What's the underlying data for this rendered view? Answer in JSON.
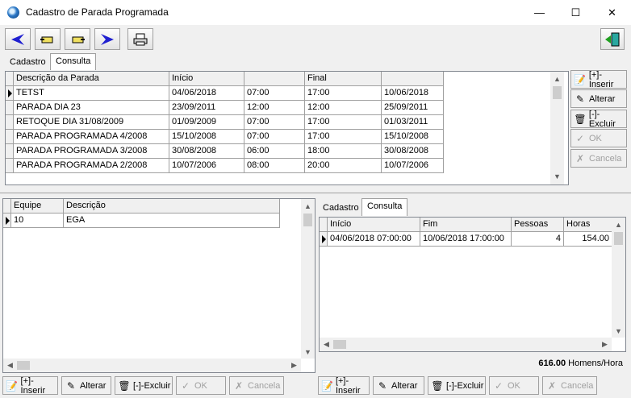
{
  "window": {
    "title": "Cadastro de Parada Programada",
    "minimize": "—",
    "maximize": "☐",
    "close": "✕"
  },
  "toolbar": {
    "buttons": [
      "back-icon",
      "hand-left-icon",
      "hand-right-icon",
      "forward-icon",
      "print-icon"
    ],
    "exit": "exit-icon"
  },
  "top_tabs": {
    "cadastro": "Cadastro",
    "consulta": "Consulta"
  },
  "paradas": {
    "columns": [
      "Descrição da Parada",
      "Início",
      "",
      "Final",
      ""
    ],
    "rows": [
      [
        "TETST",
        "04/06/2018",
        "07:00",
        "17:00",
        "10/06/2018"
      ],
      [
        "PARADA DIA 23",
        "23/09/2011",
        "12:00",
        "12:00",
        "25/09/2011"
      ],
      [
        "RETOQUE DIA 31/08/2009",
        "01/09/2009",
        "07:00",
        "17:00",
        "01/03/2011"
      ],
      [
        "PARADA PROGRAMADA  4/2008",
        "15/10/2008",
        "07:00",
        "17:00",
        "15/10/2008"
      ],
      [
        "PARADA PROGRAMADA 3/2008",
        "30/08/2008",
        "06:00",
        "18:00",
        "30/08/2008"
      ],
      [
        "PARADA PROGRAMADA 2/2008",
        "10/07/2006",
        "08:00",
        "20:00",
        "10/07/2006"
      ]
    ]
  },
  "side_buttons": {
    "inserir": "[+]-Inserir",
    "alterar": "Alterar",
    "excluir": "[-]-Excluir",
    "ok": "OK",
    "cancela": "Cancela"
  },
  "equipes": {
    "columns": [
      "Equipe",
      "Descrição"
    ],
    "rows": [
      [
        "10",
        "EGA"
      ]
    ]
  },
  "lower_tabs": {
    "cadastro": "Cadastro",
    "consulta": "Consulta"
  },
  "horarios": {
    "columns": [
      "Início",
      "Fim",
      "Pessoas",
      "Horas"
    ],
    "rows": [
      [
        "04/06/2018 07:00:00",
        "10/06/2018 17:00:00",
        "4",
        "154.00"
      ]
    ]
  },
  "total": {
    "value": "616.00",
    "unit": "Homens/Hora"
  },
  "left_buttons": {
    "inserir": "[+]-Inserir",
    "alterar": "Alterar",
    "excluir": "[-]-Excluir",
    "ok": "OK",
    "cancela": "Cancela"
  },
  "right_buttons": {
    "inserir": "[+]-Inserir",
    "alterar": "Alterar",
    "excluir": "[-]-Excluir",
    "ok": "OK",
    "cancela": "Cancela"
  }
}
